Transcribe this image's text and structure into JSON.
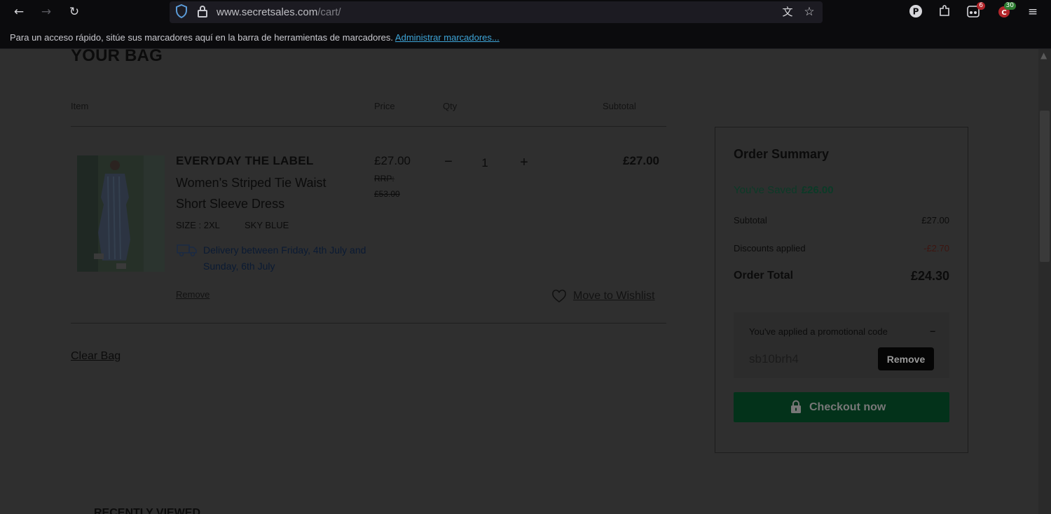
{
  "browser": {
    "url_host": "www.secretsales.com",
    "url_path": "/cart/",
    "extension_badges": [
      "6",
      "30"
    ],
    "bookmarks_text": "Para un acceso rápido, sitúe sus marcadores aquí en la barra de herramientas de marcadores.",
    "bookmarks_link": "Administrar marcadores..."
  },
  "cart": {
    "title": "YOUR BAG",
    "headers": {
      "item": "Item",
      "price": "Price",
      "qty": "Qty",
      "subtotal": "Subtotal"
    },
    "item": {
      "brand": "EVERYDAY THE LABEL",
      "name": "Women's Striped Tie Waist Short Sleeve Dress",
      "size": "SIZE : 2XL",
      "colour": "SKY BLUE",
      "delivery": "Delivery between Friday, 4th July and Sunday, 6th July",
      "price": "£27.00",
      "rrp_label": "RRP:",
      "rrp_value": "£53.00",
      "qty_minus": "−",
      "qty": "1",
      "qty_plus": "+",
      "subtotal": "£27.00",
      "remove": "Remove",
      "wishlist": "Move to Wishlist"
    },
    "clear_bag": "Clear Bag",
    "recently_viewed": "RECENTLY VIEWED"
  },
  "summary": {
    "title": "Order Summary",
    "saved_label": "You've Saved",
    "saved_value": "£26.00",
    "subtotal_label": "Subtotal",
    "subtotal_value": "£27.00",
    "discounts_label": "Discounts applied",
    "discounts_value": "-£2.70",
    "total_label": "Order Total",
    "total_value": "£24.30",
    "promo_title": "You've applied a promotional code",
    "promo_collapse": "–",
    "promo_code": "sb10brh4",
    "promo_remove": "Remove",
    "checkout": "Checkout now"
  },
  "colors": {
    "overlay_bg": "#2f2f2f",
    "checkout_green": "#03321a",
    "saved_green": "#0b3a27",
    "discount_red": "#3d1510"
  }
}
